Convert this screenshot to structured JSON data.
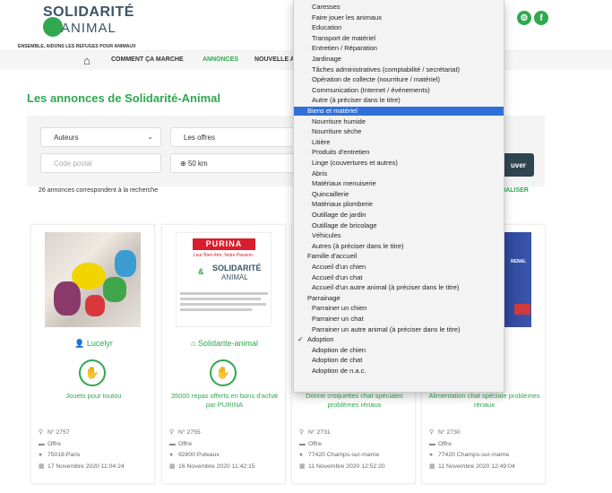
{
  "header": {
    "logo_line1": "SOLIDARITÉ",
    "logo_line2": "ANIMAL",
    "tagline": "ENSEMBLE, AIDONS LES REFUGES POUR ANIMAUX",
    "social": [
      "settings-icon",
      "facebook-icon"
    ]
  },
  "nav": {
    "items": [
      "COMMENT ÇA MARCHE",
      "ANNONCES",
      "NOUVELLE A"
    ]
  },
  "page": {
    "title": "Les annonces de Solidarité-Animal"
  },
  "filters": {
    "author_select": "Auteurs",
    "offer_select": "Les offres",
    "postal_placeholder": "Code postal",
    "distance": "50 km",
    "search_button": "uver",
    "count_text": "26 annonces correspondent à la recherche",
    "reset": "ITIALISER"
  },
  "cards": [
    {
      "author": "Lucelyr",
      "desc": "Jouets pour toutou",
      "number": "N° 2757",
      "type": "Offre",
      "place": "75018 Paris",
      "date": "17 Novembre 2020 11:04:24"
    },
    {
      "author": "Solidarite-animal",
      "desc": "35000 repas offerts en bons d'achat par PURINA",
      "number": "N° 2755",
      "type": "Offre",
      "place": "92800 Puteaux",
      "date": "16 Novembre 2020 11:42:15",
      "purina": "PURINA",
      "purina_tag": "Leur Bien-être, Notre Passion.",
      "purina_logo": "SOLIDARITÉ",
      "purina_logo2": "ANIMAL"
    },
    {
      "author": "",
      "desc": "Donne croquettes chat spéciales problèmes rénaux",
      "number": "N° 2731",
      "type": "Offre",
      "place": "77420 Champs-sur-marne",
      "date": "11 Novembre 2020 12:52:20"
    },
    {
      "author": "",
      "desc": "Alimentation chat spéciale problèmes rénaux",
      "number": "N° 2730",
      "type": "Offre",
      "place": "77420 Champs-sur-marne",
      "date": "11 Novembre 2020 12:49:04",
      "img_text": "RENAL"
    }
  ],
  "dropdown": {
    "items": [
      {
        "label": "Caresses",
        "kind": "opt"
      },
      {
        "label": "Faire jouer les animaux",
        "kind": "opt"
      },
      {
        "label": "Education",
        "kind": "opt"
      },
      {
        "label": "Transport de matériel",
        "kind": "opt"
      },
      {
        "label": "Entretien / Réparation",
        "kind": "opt"
      },
      {
        "label": "Jardinage",
        "kind": "opt"
      },
      {
        "label": "Tâches administratives (comptabilité / secrétariat)",
        "kind": "opt"
      },
      {
        "label": "Opération de collecte (nourriture / matériel)",
        "kind": "opt"
      },
      {
        "label": "Communication (Internet / événements)",
        "kind": "opt"
      },
      {
        "label": "Autre (à préciser dans le titre)",
        "kind": "opt"
      },
      {
        "label": "Biens et matériel",
        "kind": "group-hl"
      },
      {
        "label": "Nourriture humide",
        "kind": "opt"
      },
      {
        "label": "Nourriture sèche",
        "kind": "opt"
      },
      {
        "label": "Litière",
        "kind": "opt"
      },
      {
        "label": "Produits d'entretien",
        "kind": "opt"
      },
      {
        "label": "Linge (couvertures et autres)",
        "kind": "opt"
      },
      {
        "label": "Abris",
        "kind": "opt"
      },
      {
        "label": "Matériaux menuiserie",
        "kind": "opt"
      },
      {
        "label": "Quincaillerie",
        "kind": "opt"
      },
      {
        "label": "Matériaux plomberie",
        "kind": "opt"
      },
      {
        "label": "Outillage de jardin",
        "kind": "opt"
      },
      {
        "label": "Outillage de bricolage",
        "kind": "opt"
      },
      {
        "label": "Véhicules",
        "kind": "opt"
      },
      {
        "label": "Autres (à préciser dans le titre)",
        "kind": "opt"
      },
      {
        "label": "Famille d'accueil",
        "kind": "group"
      },
      {
        "label": "Accueil d'un chien",
        "kind": "opt"
      },
      {
        "label": "Accueil d'un chat",
        "kind": "opt"
      },
      {
        "label": "Accueil d'un autre animal (à préciser dans le titre)",
        "kind": "opt"
      },
      {
        "label": "Parrainage",
        "kind": "group"
      },
      {
        "label": "Parrainer un chien",
        "kind": "opt"
      },
      {
        "label": "Parrainer un chat",
        "kind": "opt"
      },
      {
        "label": "Parrainer un autre animal (à préciser dans le titre)",
        "kind": "opt"
      },
      {
        "label": "Adoption",
        "kind": "group-check"
      },
      {
        "label": "Adoption de chien",
        "kind": "opt"
      },
      {
        "label": "Adoption de chat",
        "kind": "opt"
      },
      {
        "label": "Adoption de n.a.c.",
        "kind": "opt"
      }
    ]
  }
}
